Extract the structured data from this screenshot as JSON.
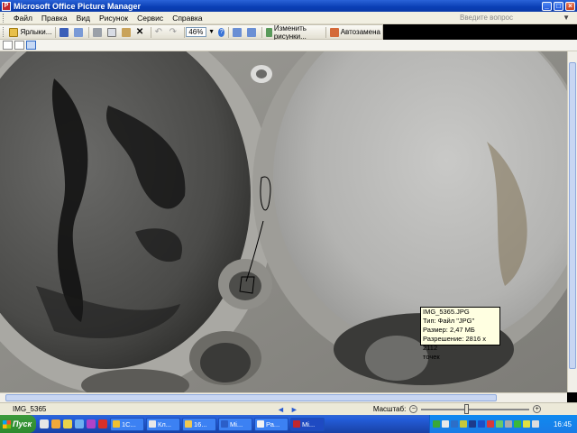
{
  "window": {
    "title": "Microsoft Office Picture Manager",
    "app_icon_letter": "P"
  },
  "menu": {
    "items": [
      "Файл",
      "Правка",
      "Вид",
      "Рисунок",
      "Сервис",
      "Справка"
    ],
    "help_placeholder": "Введите вопрос"
  },
  "toolbar": {
    "shortcuts_label": "Ярлыки...",
    "zoom_value": "46%",
    "edit_pictures_label": "Изменить рисунки...",
    "auto_correct_label": "Автозамена"
  },
  "tooltip": {
    "line1": "IMG_5365.JPG",
    "line2": "Тип: Файл \"JPG\"",
    "line3": "Размер: 2,47 МБ",
    "line4": "Разрешение: 2816 x 2112",
    "line5": "точек"
  },
  "status": {
    "filename": "IMG_5365",
    "zoom_label": "Масштаб:",
    "zoom_level_fraction": 0.42
  },
  "taskbar": {
    "start_label": "Пуск",
    "tasks": [
      "1С...",
      "Кл...",
      "16...",
      "Mi...",
      "Ра...",
      "Mi..."
    ],
    "active_task_index": 5,
    "clock": "16:45"
  },
  "colors": {
    "titlebar": "#0a3fb5",
    "tooltip_bg": "#ffffe1",
    "taskbar": "#245edb",
    "start_button": "#2e8a2e"
  }
}
